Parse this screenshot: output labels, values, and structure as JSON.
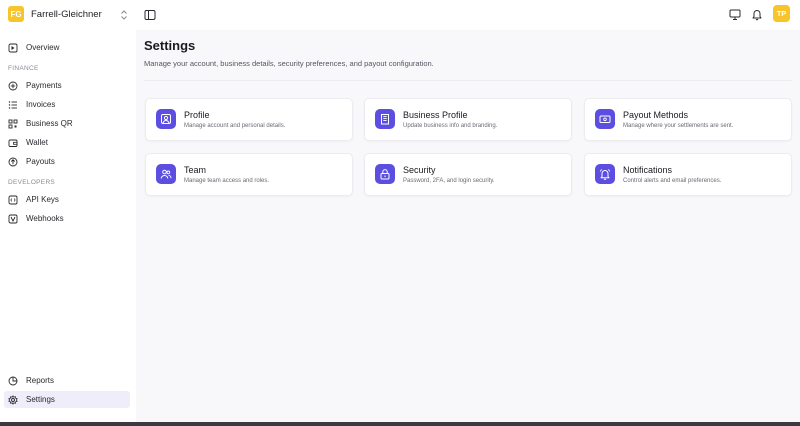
{
  "workspace": {
    "initials": "FG",
    "name": "Farrell-Gleichner"
  },
  "user": {
    "initials": "TP"
  },
  "colors": {
    "accent": "#5b4ee0",
    "brand_yellow": "#f7c52b",
    "active_bg": "#eeedf9"
  },
  "sidebar": {
    "overview": {
      "label": "Overview",
      "icon": "overview-icon"
    },
    "finance_section": "FINANCE",
    "finance_items": [
      {
        "label": "Payments",
        "icon": "payments-icon"
      },
      {
        "label": "Invoices",
        "icon": "invoices-icon"
      },
      {
        "label": "Business QR",
        "icon": "qr-icon"
      },
      {
        "label": "Wallet",
        "icon": "wallet-icon"
      },
      {
        "label": "Payouts",
        "icon": "payouts-icon"
      }
    ],
    "developers_section": "DEVELOPERS",
    "developer_items": [
      {
        "label": "API Keys",
        "icon": "api-keys-icon"
      },
      {
        "label": "Webhooks",
        "icon": "webhooks-icon"
      }
    ],
    "bottom_items": [
      {
        "label": "Reports",
        "icon": "reports-icon"
      },
      {
        "label": "Settings",
        "icon": "settings-icon",
        "active": true
      }
    ]
  },
  "main": {
    "title": "Settings",
    "subtitle": "Manage your account, business details, security preferences, and payout configuration.",
    "cards": [
      {
        "title": "Profile",
        "description": "Manage account and personal details.",
        "icon": "profile-icon"
      },
      {
        "title": "Business Profile",
        "description": "Update business info and branding.",
        "icon": "building-icon"
      },
      {
        "title": "Payout Methods",
        "description": "Manage where your settlements are sent.",
        "icon": "payout-method-icon"
      },
      {
        "title": "Team",
        "description": "Manage team access and roles.",
        "icon": "team-icon"
      },
      {
        "title": "Security",
        "description": "Password, 2FA, and login security.",
        "icon": "lock-icon"
      },
      {
        "title": "Notifications",
        "description": "Control alerts and email preferences.",
        "icon": "bell-icon"
      }
    ]
  }
}
